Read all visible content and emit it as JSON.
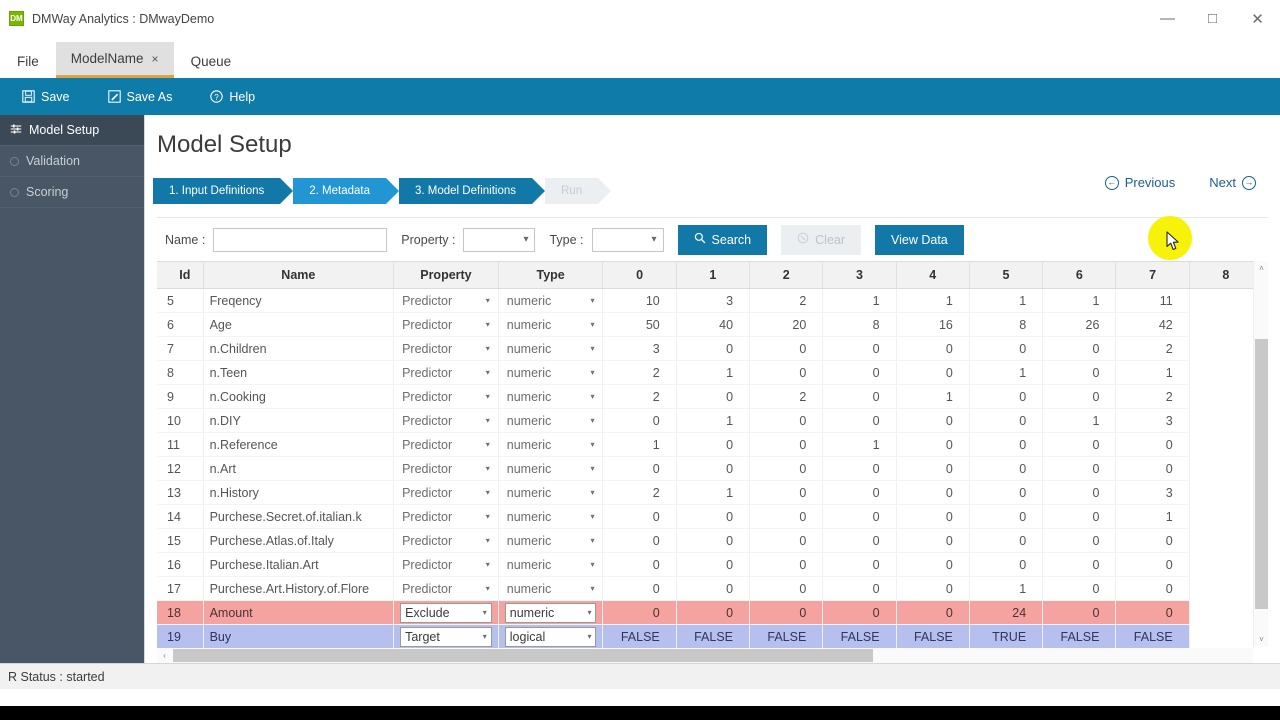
{
  "window": {
    "title": "DMWay Analytics : DMwayDemo",
    "app_icon": "app-logo-icon",
    "minimize": "—",
    "maximize": "□",
    "close": "✕"
  },
  "tabs": [
    {
      "label": "File",
      "active": false,
      "closable": false
    },
    {
      "label": "ModelName",
      "active": true,
      "closable": true,
      "close_glyph": "×"
    },
    {
      "label": "Queue",
      "active": false,
      "closable": false
    }
  ],
  "toolbar": {
    "items": [
      {
        "label": "Save",
        "icon": "floppy-disk-icon"
      },
      {
        "label": "Save As",
        "icon": "edit-square-icon"
      },
      {
        "label": "Help",
        "icon": "question-circle-icon"
      }
    ]
  },
  "sidebar": {
    "items": [
      {
        "label": "Model Setup",
        "active": true,
        "icon": "sliders-icon"
      },
      {
        "label": "Validation",
        "active": false,
        "icon": "circle-icon"
      },
      {
        "label": "Scoring",
        "active": false,
        "icon": "circle-icon"
      }
    ]
  },
  "main": {
    "page_title": "Model Setup",
    "steps": [
      {
        "label": "1. Input Definitions",
        "state": "done"
      },
      {
        "label": "2. Metadata",
        "state": "current"
      },
      {
        "label": "3. Model Definitions",
        "state": "done"
      },
      {
        "label": "Run",
        "state": "disabled"
      }
    ],
    "nav": {
      "previous": "Previous",
      "next": "Next",
      "prev_glyph": "←",
      "next_glyph": "→"
    },
    "search": {
      "name_label": "Name :",
      "name_value": "",
      "name_placeholder": "",
      "property_label": "Property :",
      "property_value": "",
      "type_label": "Type :",
      "type_value": "",
      "caret": "▾",
      "search_button": "Search",
      "search_icon": "magnifier-icon",
      "clear_button": "Clear",
      "clear_icon": "clear-circle-icon",
      "view_data_button": "View Data"
    }
  },
  "table": {
    "headers": [
      "Id",
      "Name",
      "Property",
      "Type",
      "0",
      "1",
      "2",
      "3",
      "4",
      "5",
      "6",
      "7",
      "8"
    ],
    "caret": "▾",
    "rows": [
      {
        "id": "5",
        "name": "Freqency",
        "property": "Predictor",
        "type": "numeric",
        "values": [
          "10",
          "3",
          "2",
          "1",
          "1",
          "1",
          "1",
          "11"
        ],
        "highlight": "none"
      },
      {
        "id": "6",
        "name": "Age",
        "property": "Predictor",
        "type": "numeric",
        "values": [
          "50",
          "40",
          "20",
          "8",
          "16",
          "8",
          "26",
          "42"
        ],
        "highlight": "none"
      },
      {
        "id": "7",
        "name": "n.Children",
        "property": "Predictor",
        "type": "numeric",
        "values": [
          "3",
          "0",
          "0",
          "0",
          "0",
          "0",
          "0",
          "2"
        ],
        "highlight": "none"
      },
      {
        "id": "8",
        "name": "n.Teen",
        "property": "Predictor",
        "type": "numeric",
        "values": [
          "2",
          "1",
          "0",
          "0",
          "0",
          "1",
          "0",
          "1"
        ],
        "highlight": "none"
      },
      {
        "id": "9",
        "name": "n.Cooking",
        "property": "Predictor",
        "type": "numeric",
        "values": [
          "2",
          "0",
          "2",
          "0",
          "1",
          "0",
          "0",
          "2"
        ],
        "highlight": "none"
      },
      {
        "id": "10",
        "name": "n.DIY",
        "property": "Predictor",
        "type": "numeric",
        "values": [
          "0",
          "1",
          "0",
          "0",
          "0",
          "0",
          "1",
          "3"
        ],
        "highlight": "none"
      },
      {
        "id": "11",
        "name": "n.Reference",
        "property": "Predictor",
        "type": "numeric",
        "values": [
          "1",
          "0",
          "0",
          "1",
          "0",
          "0",
          "0",
          "0"
        ],
        "highlight": "none"
      },
      {
        "id": "12",
        "name": "n.Art",
        "property": "Predictor",
        "type": "numeric",
        "values": [
          "0",
          "0",
          "0",
          "0",
          "0",
          "0",
          "0",
          "0"
        ],
        "highlight": "none"
      },
      {
        "id": "13",
        "name": "n.History",
        "property": "Predictor",
        "type": "numeric",
        "values": [
          "2",
          "1",
          "0",
          "0",
          "0",
          "0",
          "0",
          "3"
        ],
        "highlight": "none"
      },
      {
        "id": "14",
        "name": "Purchese.Secret.of.italian.k",
        "property": "Predictor",
        "type": "numeric",
        "values": [
          "0",
          "0",
          "0",
          "0",
          "0",
          "0",
          "0",
          "1"
        ],
        "highlight": "none"
      },
      {
        "id": "15",
        "name": "Purchese.Atlas.of.Italy",
        "property": "Predictor",
        "type": "numeric",
        "values": [
          "0",
          "0",
          "0",
          "0",
          "0",
          "0",
          "0",
          "0"
        ],
        "highlight": "none"
      },
      {
        "id": "16",
        "name": "Purchese.Italian.Art",
        "property": "Predictor",
        "type": "numeric",
        "values": [
          "0",
          "0",
          "0",
          "0",
          "0",
          "0",
          "0",
          "0"
        ],
        "highlight": "none"
      },
      {
        "id": "17",
        "name": "Purchese.Art.History.of.Flore",
        "property": "Predictor",
        "type": "numeric",
        "values": [
          "0",
          "0",
          "0",
          "0",
          "0",
          "1",
          "0",
          "0"
        ],
        "highlight": "none"
      },
      {
        "id": "18",
        "name": "Amount",
        "property": "Exclude",
        "type": "numeric",
        "values": [
          "0",
          "0",
          "0",
          "0",
          "0",
          "24",
          "0",
          "0"
        ],
        "highlight": "red"
      },
      {
        "id": "19",
        "name": "Buy",
        "property": "Target",
        "type": "logical",
        "values": [
          "FALSE",
          "FALSE",
          "FALSE",
          "FALSE",
          "FALSE",
          "TRUE",
          "FALSE",
          "FALSE"
        ],
        "highlight": "blue"
      }
    ],
    "scroll": {
      "up_arrow": "˄",
      "down_arrow": "˅",
      "left_arrow": "‹",
      "right_arrow": "›"
    }
  },
  "status": {
    "text": "R Status : started"
  },
  "colors": {
    "toolbar_blue": "#0e7ba8",
    "step_blue": "#1278a8",
    "step_current_blue": "#2196d3",
    "sidebar_dark": "#485665",
    "row_red": "#f4a3a0",
    "row_blue": "#b6c0ef",
    "cursor_highlight": "#f7f20a",
    "tab_accent": "#d9a441"
  }
}
